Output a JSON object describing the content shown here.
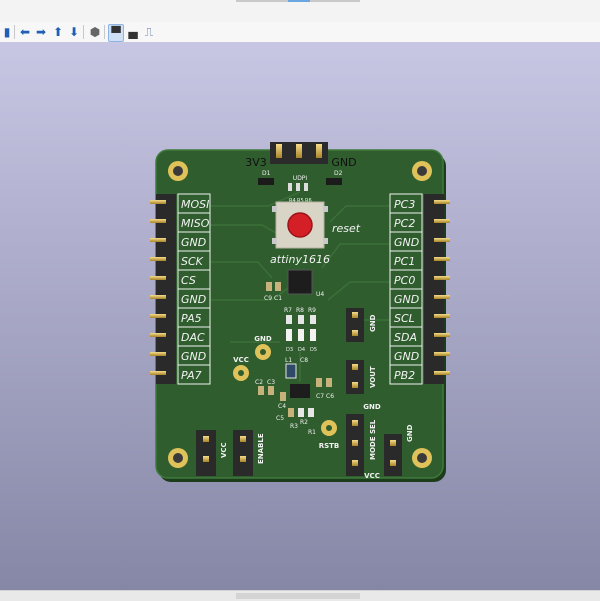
{
  "toolbar": {
    "buttons": [
      {
        "name": "panel-toggle-icon",
        "glyph": "▮"
      },
      {
        "name": "arrow-left-icon",
        "glyph": "⬅"
      },
      {
        "name": "arrow-right-icon",
        "glyph": "➡"
      },
      {
        "name": "arrow-up-icon",
        "glyph": "⬆"
      },
      {
        "name": "arrow-down-icon",
        "glyph": "⬇"
      },
      {
        "name": "cube-view-icon",
        "glyph": "⬢"
      },
      {
        "name": "board-view-top-icon",
        "glyph": "▀"
      },
      {
        "name": "board-view-bottom-icon",
        "glyph": "▄"
      },
      {
        "name": "ruler-icon",
        "glyph": "⎍"
      }
    ]
  },
  "board": {
    "header": {
      "left": "3V3",
      "right": "GND",
      "udpi": "UDPI"
    },
    "left_pins": [
      "MOSI",
      "MISO",
      "GND",
      "SCK",
      "CS",
      "GND",
      "PA5",
      "DAC",
      "GND",
      "PA7"
    ],
    "right_pins": [
      "PC3",
      "PC2",
      "GND",
      "PC1",
      "PC0",
      "GND",
      "SCL",
      "SDA",
      "GND",
      "PB2"
    ],
    "reset_label": "reset",
    "mcu_label": "attiny1616",
    "test_points": {
      "gnd": "GND",
      "vcc": "VCC",
      "rstb": "RSTB"
    },
    "connectors": {
      "gnd_top": "GND",
      "vout": "VOUT",
      "gnd_mid": "GND",
      "mode_sel": "MODE SEL",
      "gnd_right": "GND",
      "vcc_bottom": "VCC",
      "vcc_left": "VCC",
      "enable": "ENABLE"
    },
    "refdes": {
      "d1": "D1",
      "d2": "D2",
      "r4": "R4",
      "r5": "R5",
      "r6": "R6",
      "c9": "C9",
      "c1": "C1",
      "u4": "U4",
      "r7": "R7",
      "r8": "R8",
      "r9": "R9",
      "d3": "D3",
      "d4": "D4",
      "d5": "D5",
      "c8": "C8",
      "l1": "L1",
      "c2": "C2",
      "c3": "C3",
      "c4": "C4",
      "c7": "C7",
      "c6": "C6",
      "c5": "C5",
      "r2": "R2",
      "r1": "R1",
      "r3": "R3"
    }
  },
  "colors": {
    "pcb": "#2f5d2e",
    "silk": "#f2f2f2",
    "copper": "#c9b24a",
    "button": "#d41f27",
    "viewport_top": "#c7c7e4",
    "viewport_bottom": "#8686a6"
  }
}
